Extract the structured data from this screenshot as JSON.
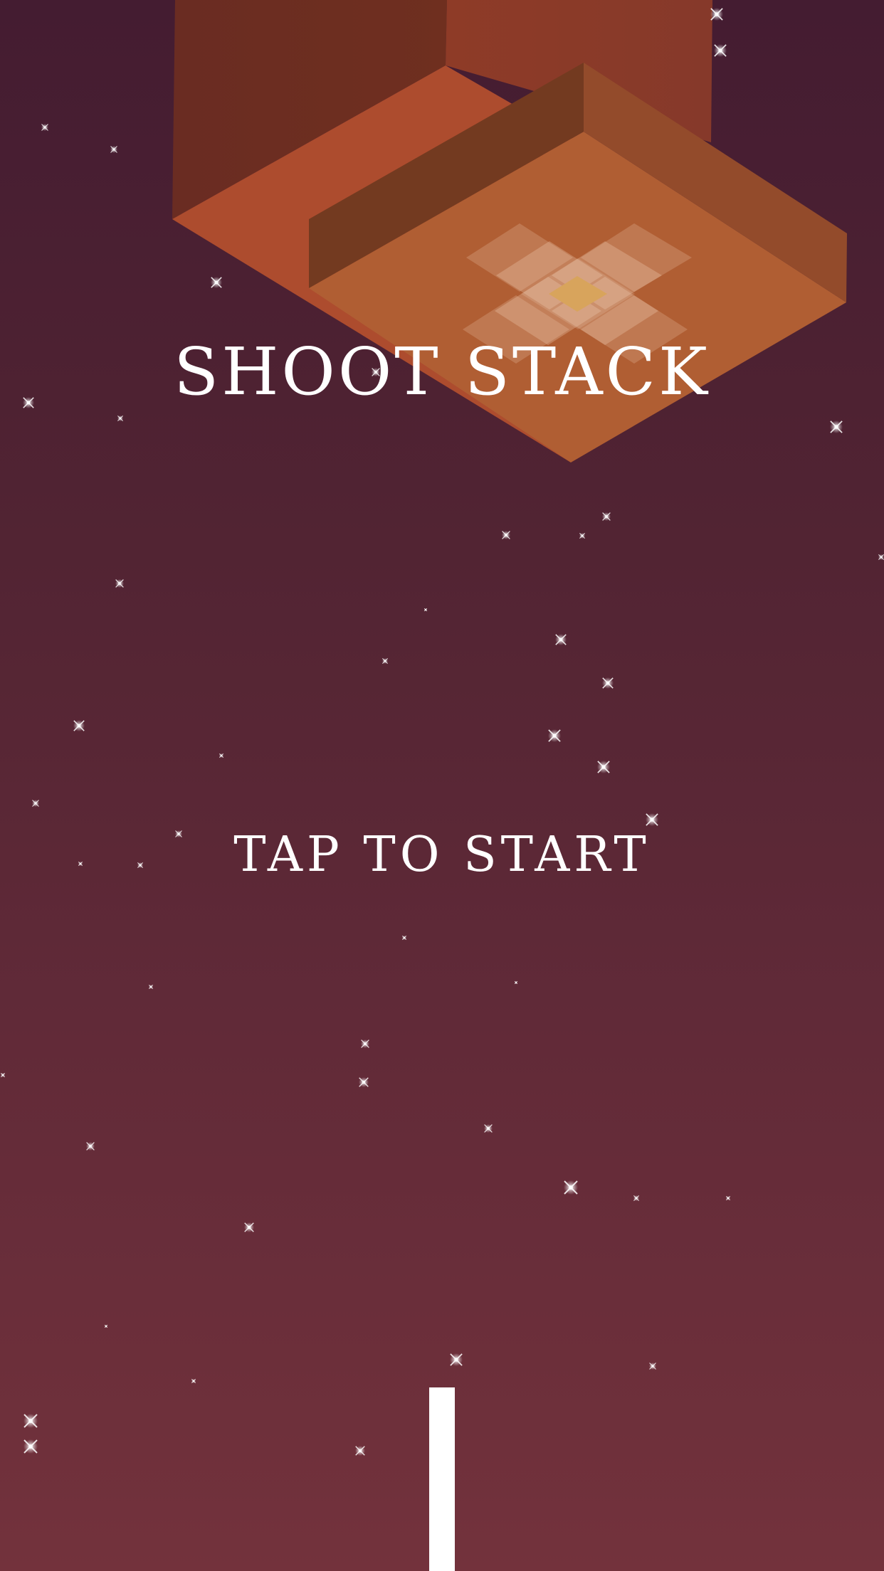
{
  "game": {
    "title": "SHOOT STACK",
    "start_prompt": "TAP TO START"
  },
  "colors": {
    "background_top": "#441c31",
    "background_bottom": "#73323c",
    "tower_front": "#6e2e20",
    "tower_side": "#8a3d27",
    "slab_top_left": "#b04d2e",
    "slab_top_right": "#b05d32",
    "slab_wall_front": "#733a20",
    "slab_wall_side": "#934b2b",
    "highlight_tile": "#f6d8c0",
    "center_tile": "#d8a45c",
    "text": "#ffffff",
    "shooter_bar": "#ffffff",
    "star": "#ffffff"
  }
}
